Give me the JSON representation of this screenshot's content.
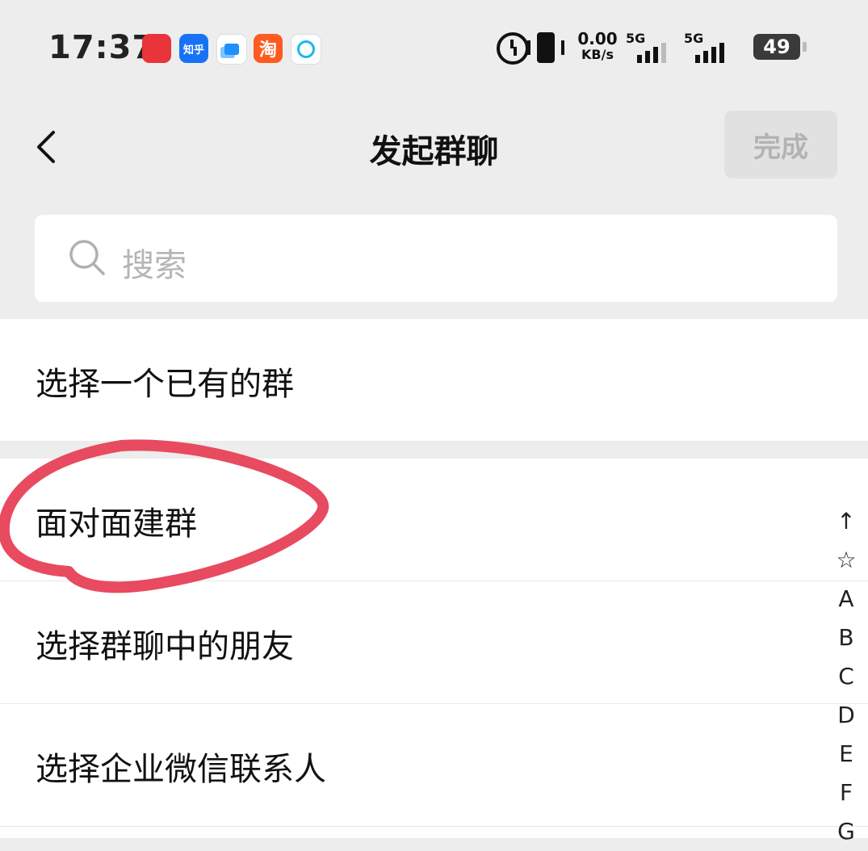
{
  "status_bar": {
    "time": "17:37",
    "apps": [
      "",
      "知乎",
      "",
      "淘",
      ""
    ],
    "net_speed_value": "0.00",
    "net_speed_unit": "KB/s",
    "signal_1_label": "5G",
    "signal_2_label": "5G",
    "battery": "49"
  },
  "nav": {
    "title": "发起群聊",
    "done_label": "完成"
  },
  "search": {
    "placeholder": "搜索"
  },
  "options": [
    {
      "label": "选择一个已有的群"
    },
    {
      "label": "面对面建群"
    },
    {
      "label": "选择群聊中的朋友"
    },
    {
      "label": "选择企业微信联系人"
    }
  ],
  "index_bar": [
    "↑",
    "☆",
    "A",
    "B",
    "C",
    "D",
    "E",
    "F",
    "G"
  ],
  "colors": {
    "background": "#ededed",
    "annotation": "#e84a5f",
    "done_bg": "#e1e1e1",
    "done_text": "#b3b3b3"
  }
}
